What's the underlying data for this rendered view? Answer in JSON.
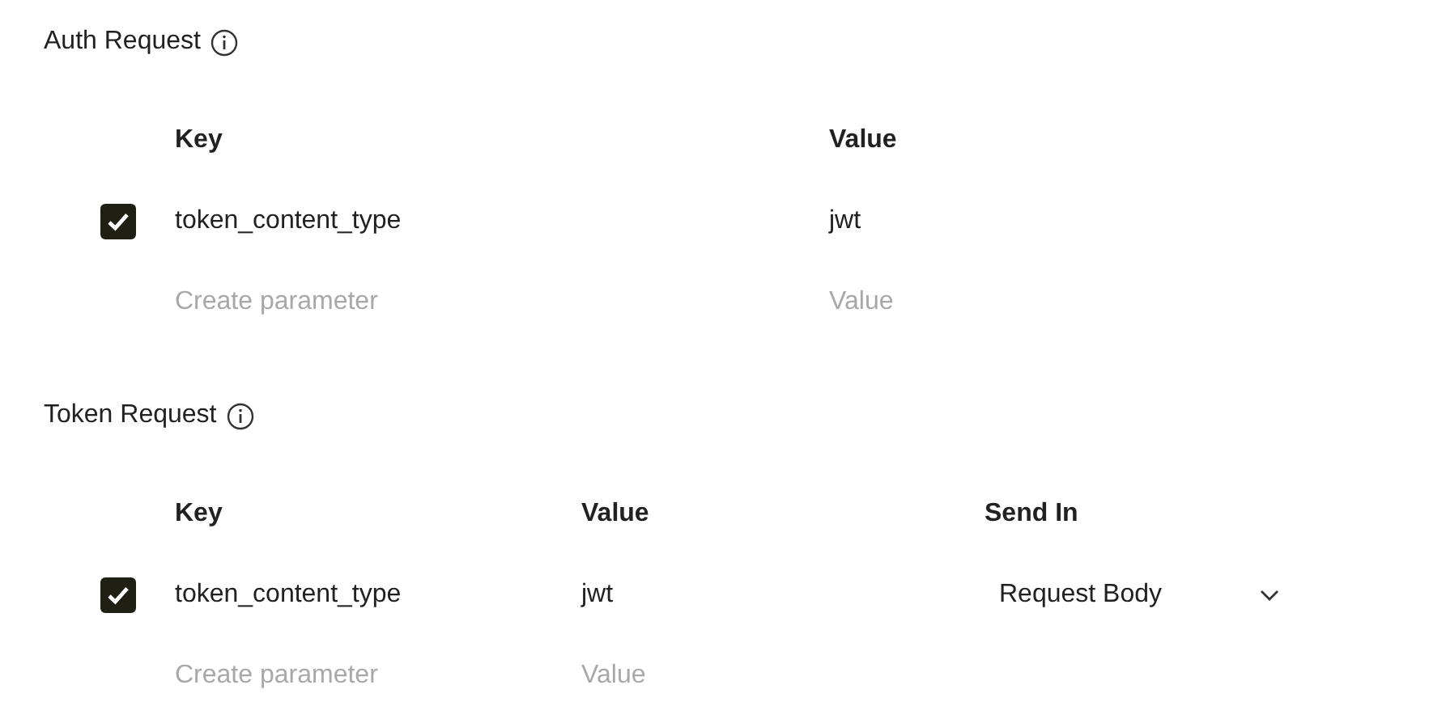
{
  "sections": [
    {
      "title": "Auth Request",
      "columns": [
        "Key",
        "Value"
      ],
      "rows": [
        {
          "checked": true,
          "key": "token_content_type",
          "value": "jwt"
        }
      ],
      "new_row": {
        "key_placeholder": "Create parameter",
        "value_placeholder": "Value"
      }
    },
    {
      "title": "Token Request",
      "columns": [
        "Key",
        "Value",
        "Send In"
      ],
      "rows": [
        {
          "checked": true,
          "key": "token_content_type",
          "value": "jwt",
          "send_in": "Request Body"
        }
      ],
      "new_row": {
        "key_placeholder": "Create parameter",
        "value_placeholder": "Value"
      }
    }
  ]
}
